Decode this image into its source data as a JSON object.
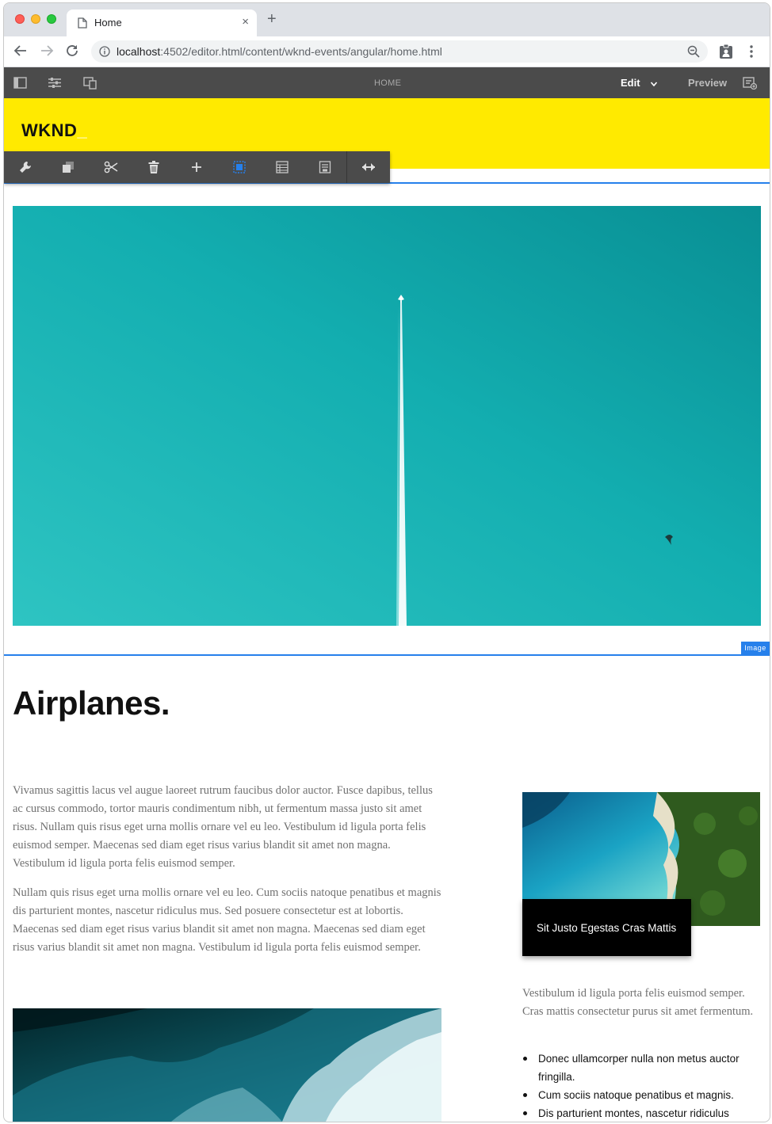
{
  "browser": {
    "tab_title": "Home",
    "new_tab_label": "+",
    "close_label": "×",
    "url_host": "localhost",
    "url_path": ":4502/editor.html/content/wknd-events/angular/home.html"
  },
  "editor": {
    "page_name": "HOME",
    "mode_edit": "Edit",
    "mode_preview": "Preview",
    "toolbar_icons": [
      "wrench-icon",
      "copy-icon",
      "cut-icon",
      "delete-icon",
      "insert-icon",
      "group-icon",
      "layout-icon",
      "template-icon",
      "resize-icon"
    ],
    "selection_label": "Image",
    "accent_color": "#2680eb"
  },
  "page": {
    "logo": "WKND",
    "logo_cursor": "_",
    "brand_color": "#ffea00",
    "headline": "Airplanes.",
    "paragraph_1": "Vivamus sagittis lacus vel augue laoreet rutrum faucibus dolor auctor. Fusce dapibus, tellus ac cursus commodo, tortor mauris condimentum nibh, ut fermentum massa justo sit amet risus. Nullam quis risus eget urna mollis ornare vel eu leo. Vestibulum id ligula porta felis euismod semper. Maecenas sed diam eget risus varius blandit sit amet non magna. Vestibulum id ligula porta felis euismod semper.",
    "paragraph_2": "Nullam quis risus eget urna mollis ornare vel eu leo. Cum sociis natoque penatibus et magnis dis parturient montes, nascetur ridiculus mus. Sed posuere consectetur est at lobortis. Maecenas sed diam eget risus varius blandit sit amet non magna. Maecenas sed diam eget risus varius blandit sit amet non magna. Vestibulum id ligula porta felis euismod semper.",
    "teaser_title": "Sit Justo Egestas Cras Mattis",
    "side_paragraph": "Vestibulum id ligula porta felis euismod semper. Cras mattis consectetur purus sit amet fermentum.",
    "side_list": [
      "Donec ullamcorper nulla non metus auctor fringilla.",
      "Cum sociis natoque penatibus et magnis.",
      "Dis parturient montes, nascetur ridiculus"
    ]
  }
}
